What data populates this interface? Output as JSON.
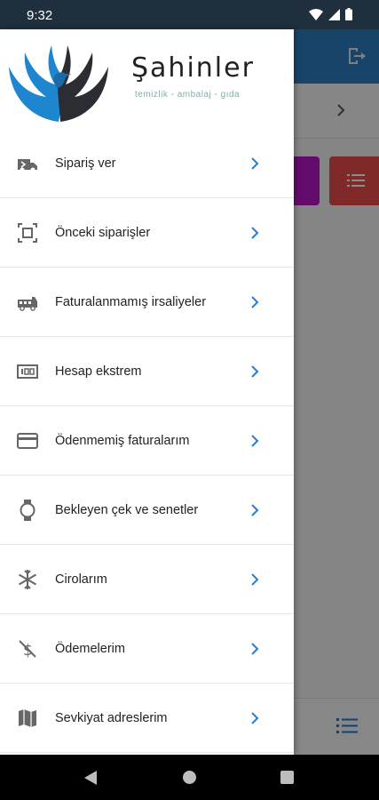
{
  "status_bar": {
    "time": "9:32"
  },
  "brand": {
    "name": "Şahinler",
    "tagline": "temizlik - ambalaj - gıda"
  },
  "colors": {
    "accent": "#2e7cbf",
    "chevron": "#2a7bd0",
    "status_bar": "#1f2f3e"
  },
  "menu": {
    "items": [
      {
        "label": "Sipariş ver",
        "icon": "truck-arrow-icon"
      },
      {
        "label": "Önceki siparişler",
        "icon": "frame-icon"
      },
      {
        "label": "Faturalanmamış irsaliyeler",
        "icon": "firetruck-icon"
      },
      {
        "label": "Hesap ekstrem",
        "icon": "counter-icon"
      },
      {
        "label": "Ödenmemiş faturalarım",
        "icon": "credit-card-icon"
      },
      {
        "label": "Bekleyen çek ve senetler",
        "icon": "watch-icon"
      },
      {
        "label": "Cirolarım",
        "icon": "snowflake-icon"
      },
      {
        "label": "Ödemelerim",
        "icon": "money-off-icon"
      },
      {
        "label": "Sevkiyat adreslerim",
        "icon": "map-icon"
      }
    ]
  }
}
